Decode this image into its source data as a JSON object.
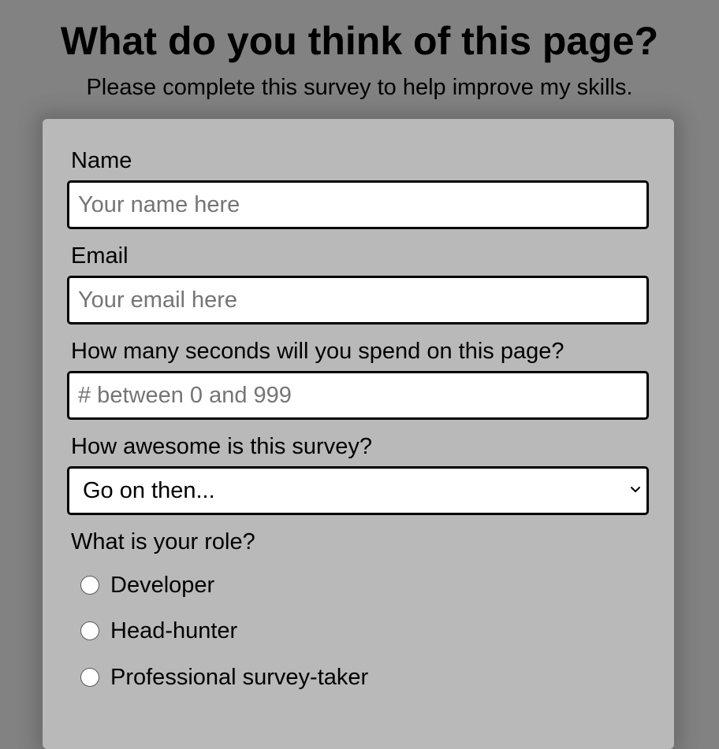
{
  "header": {
    "title": "What do you think of this page?",
    "subtitle": "Please complete this survey to help improve my skills."
  },
  "form": {
    "name": {
      "label": "Name",
      "placeholder": "Your name here",
      "value": ""
    },
    "email": {
      "label": "Email",
      "placeholder": "Your email here",
      "value": ""
    },
    "seconds": {
      "label": "How many seconds will you spend on this page?",
      "placeholder": "# between 0 and 999",
      "value": ""
    },
    "awesome": {
      "label": "How awesome is this survey?",
      "selected": "Go on then..."
    },
    "role": {
      "label": "What is your role?",
      "options": [
        "Developer",
        "Head-hunter",
        "Professional survey-taker"
      ]
    }
  },
  "colors": {
    "page_background": "#828282",
    "card_background": "#b9b9b9",
    "input_border": "#000000"
  },
  "icons": {
    "select_indicator": "chevron-down-icon"
  }
}
